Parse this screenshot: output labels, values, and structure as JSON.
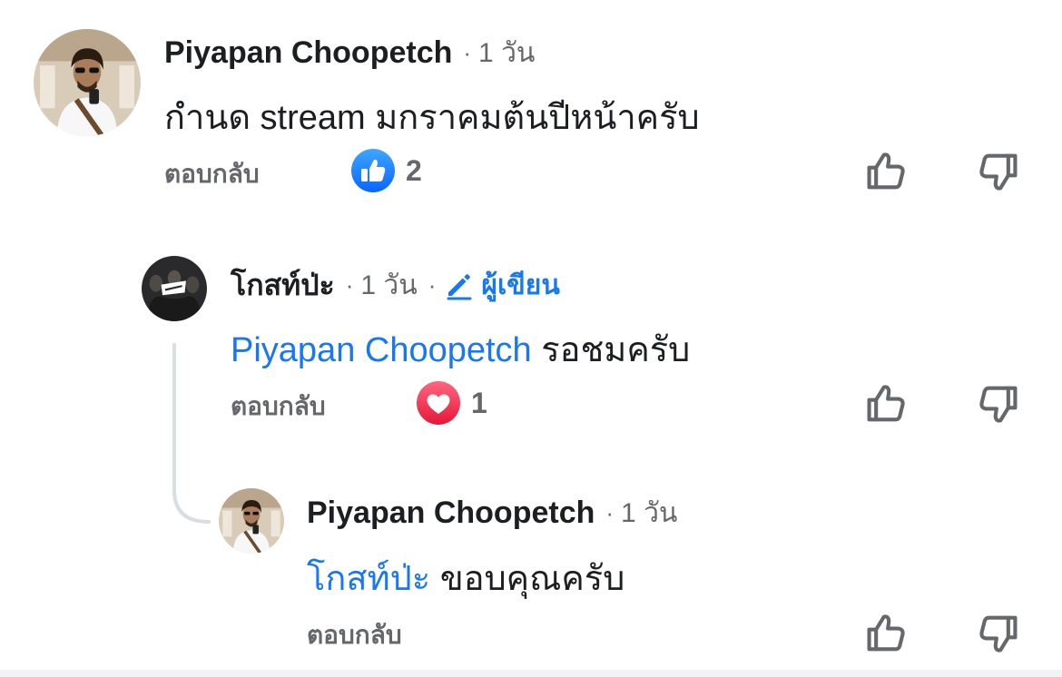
{
  "comments": [
    {
      "author": "Piyapan Choopetch",
      "time": "1 วัน",
      "text": "กำนด stream มกราคมต้นปีหน้าครับ",
      "reply_label": "ตอบกลับ",
      "reaction": {
        "type": "like",
        "count": "2",
        "color": "#1877f2"
      }
    },
    {
      "author": "โกสท์ป่ะ",
      "time": "1 วัน",
      "author_badge": "ผู้เขียน",
      "mention": "Piyapan Choopetch",
      "text": "รอชมครับ",
      "reply_label": "ตอบกลับ",
      "reaction": {
        "type": "love",
        "count": "1",
        "color": "#f33e58"
      }
    },
    {
      "author": "Piyapan Choopetch",
      "time": "1 วัน",
      "mention": "โกสท์ป่ะ",
      "text": "ขอบคุณครับ",
      "reply_label": "ตอบกลับ"
    }
  ],
  "separator": "·",
  "icons": {
    "upvote": "thumbs-up-outline-icon",
    "downvote": "thumbs-down-outline-icon",
    "author_badge": "pencil-icon"
  }
}
